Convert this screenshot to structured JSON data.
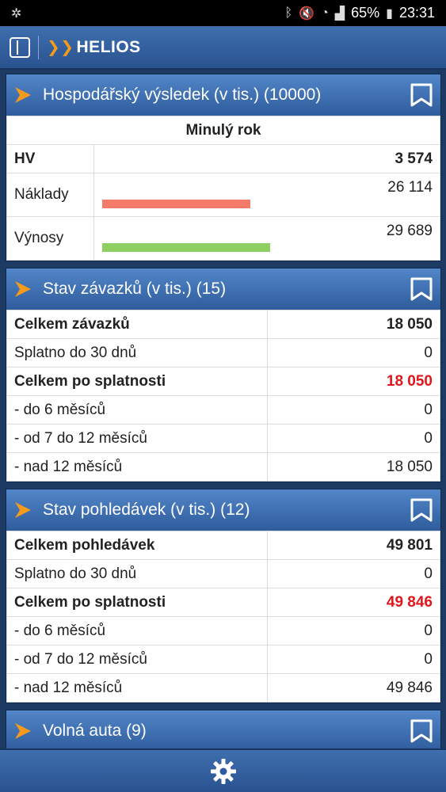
{
  "status": {
    "battery": "65%",
    "time": "23:31"
  },
  "app": {
    "logo_text": "HELIOS"
  },
  "hv_panel": {
    "title": "Hospodářský výsledek (v tis.) (10000)",
    "period": "Minulý rok",
    "rows": [
      {
        "label": "HV",
        "value": "3 574"
      },
      {
        "label": "Náklady",
        "value": "26 114",
        "bar_fraction": 0.45,
        "bar_color": "#f47a6a"
      },
      {
        "label": "Výnosy",
        "value": "29 689",
        "bar_fraction": 0.51,
        "bar_color": "#8dcf61"
      }
    ]
  },
  "zavazky_panel": {
    "title": "Stav závazků (v tis.) (15)",
    "rows": [
      {
        "label": "Celkem závazků",
        "value": "18 050"
      },
      {
        "label": "Splatno do 30 dnů",
        "value": "0"
      },
      {
        "label": "Celkem po splatnosti",
        "value": "18 050"
      },
      {
        "label": "- do 6 měsíců",
        "value": "0"
      },
      {
        "label": "- od 7 do 12 měsíců",
        "value": "0"
      },
      {
        "label": "- nad 12 měsíců",
        "value": "18 050"
      }
    ]
  },
  "pohledavky_panel": {
    "title": "Stav pohledávek (v tis.) (12)",
    "rows": [
      {
        "label": "Celkem pohledávek",
        "value": "49 801"
      },
      {
        "label": "Splatno do 30 dnů",
        "value": "0"
      },
      {
        "label": "Celkem po splatnosti",
        "value": "49 846"
      },
      {
        "label": "- do 6 měsíců",
        "value": "0"
      },
      {
        "label": "- od 7 do 12 měsíců",
        "value": "0"
      },
      {
        "label": "- nad 12 měsíců",
        "value": "49 846"
      }
    ]
  },
  "auta_panel": {
    "title": "Volná auta (9)"
  },
  "colors": {
    "accent_orange": "#f49a1c",
    "overdue_red": "#e0161b",
    "header_blue": "#3f6fae"
  }
}
